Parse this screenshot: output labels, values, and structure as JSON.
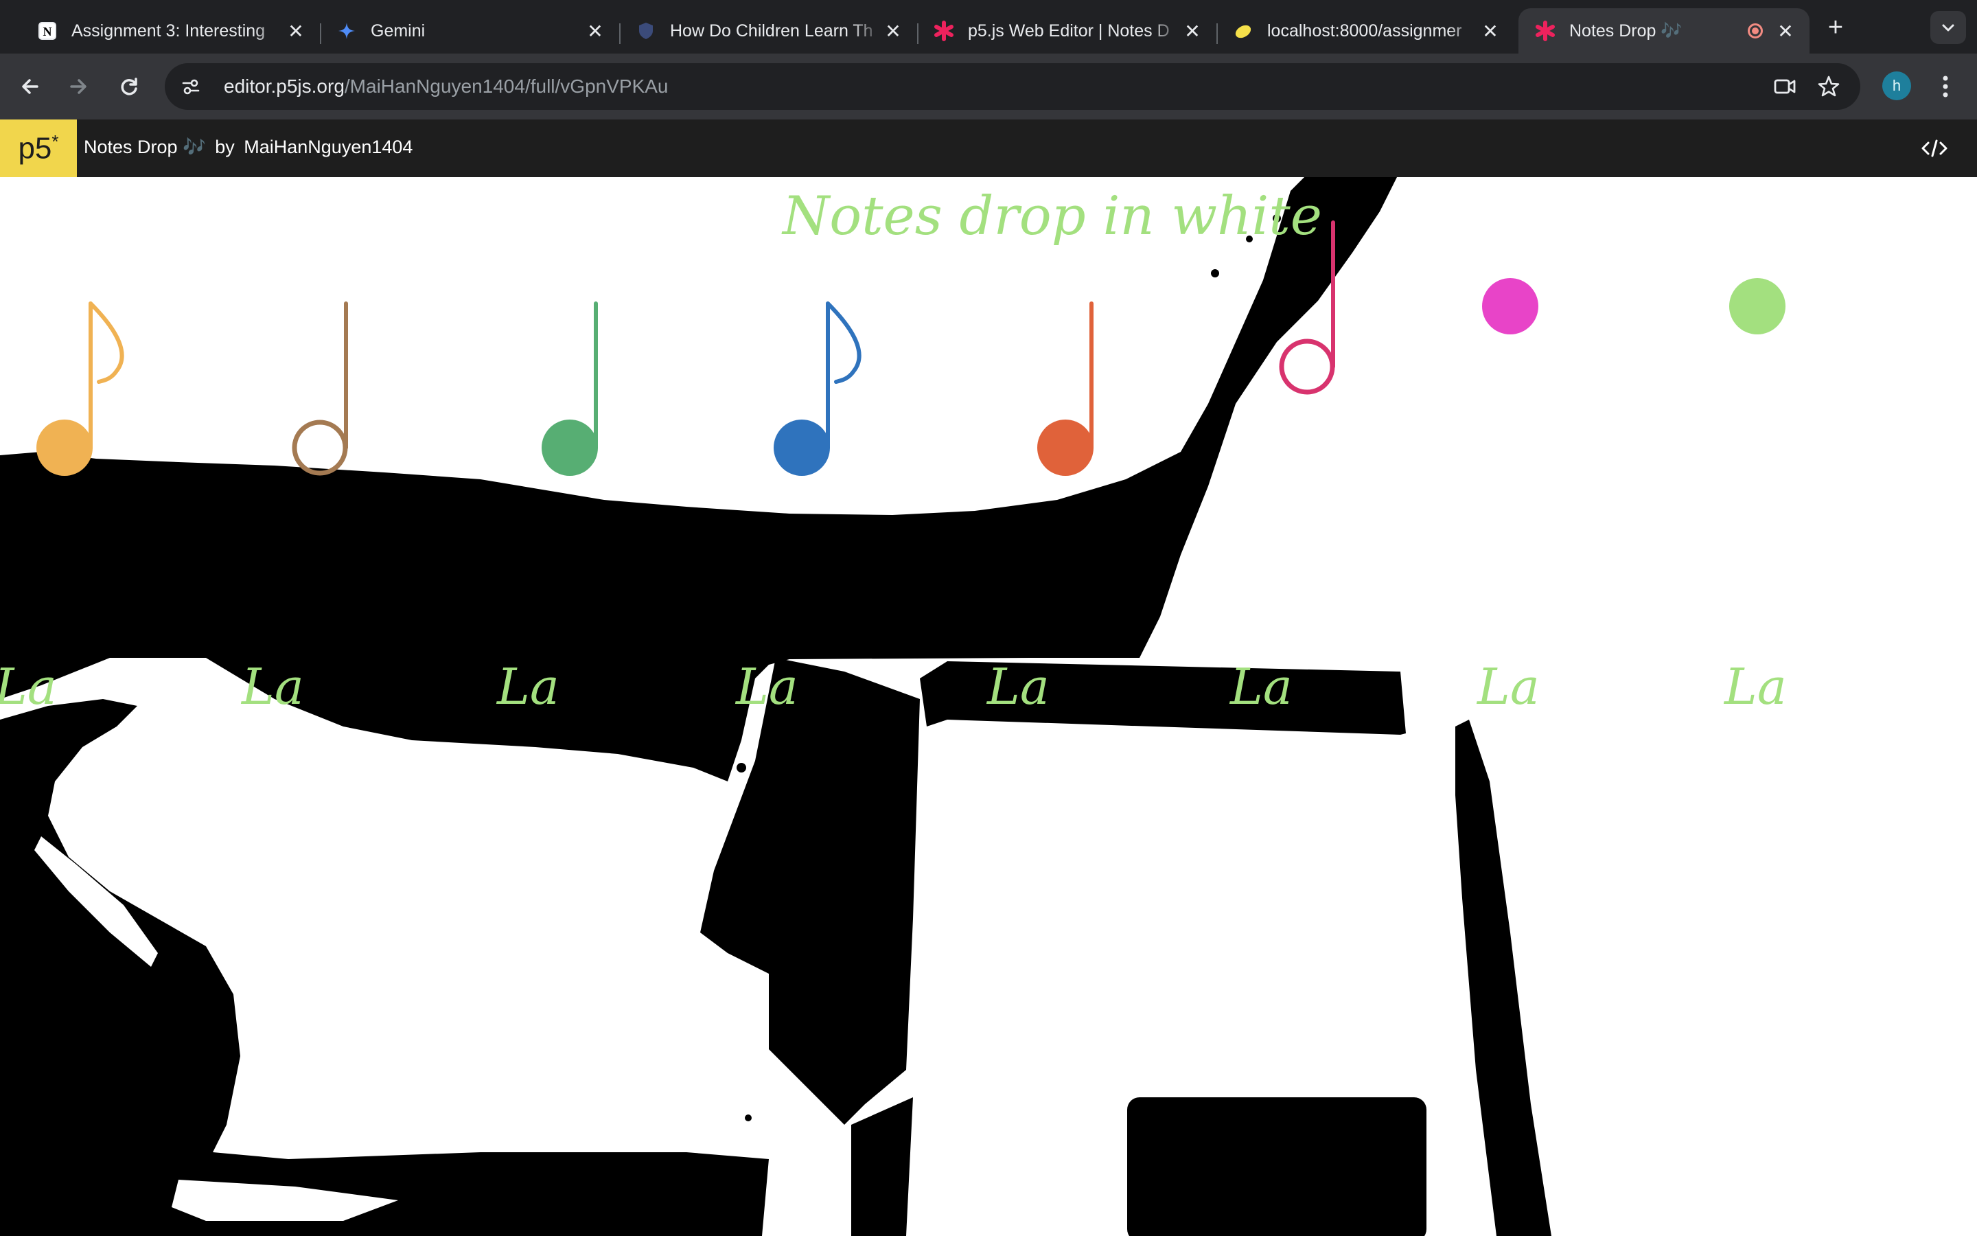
{
  "browser": {
    "tabs": [
      {
        "title": "Assignment 3: Interesting",
        "icon": "notion-icon",
        "active": false
      },
      {
        "title": "Gemini",
        "icon": "gemini-icon",
        "active": false
      },
      {
        "title": "How Do Children Learn Th",
        "icon": "shield-icon",
        "active": false
      },
      {
        "title": "p5.js Web Editor | Notes D",
        "icon": "p5-asterisk-icon",
        "active": false
      },
      {
        "title": "localhost:8000/assignmer",
        "icon": "lemon-icon",
        "active": false
      },
      {
        "title": "Notes Drop 🎶",
        "icon": "p5-asterisk-icon",
        "active": true
      }
    ],
    "new_tab_label": "+",
    "address_bar": {
      "domain": "editor.p5js.org",
      "path": "/MaiHanNguyen1404/full/vGpnVPKAu"
    },
    "profile_initial": "h"
  },
  "p5_header": {
    "logo": "p5",
    "logo_mark": "*",
    "sketch_name": "Notes Drop 🎶",
    "by_label": "by",
    "author": "MaiHanNguyen1404"
  },
  "canvas": {
    "heading": "Notes drop in white",
    "la_labels": [
      "La",
      "La",
      "La",
      "La",
      "La",
      "La",
      "La",
      "La"
    ],
    "notes": [
      {
        "kind": "eighth-filled",
        "color": "#f0b253"
      },
      {
        "kind": "half-hollow",
        "color": "#a47a52"
      },
      {
        "kind": "quarter-filled",
        "color": "#57ae73"
      },
      {
        "kind": "eighth-filled",
        "color": "#2f73bd"
      },
      {
        "kind": "quarter-filled",
        "color": "#e0623a"
      },
      {
        "kind": "half-hollow",
        "color": "#d8336e"
      },
      {
        "kind": "dot",
        "color": "#e844c8"
      },
      {
        "kind": "dot",
        "color": "#a3e07f"
      }
    ]
  },
  "colors": {
    "tab_bar": "#202124",
    "toolbar": "#35363a",
    "p5_yellow": "#f1d64c",
    "heading_green": "#a3e07f"
  }
}
